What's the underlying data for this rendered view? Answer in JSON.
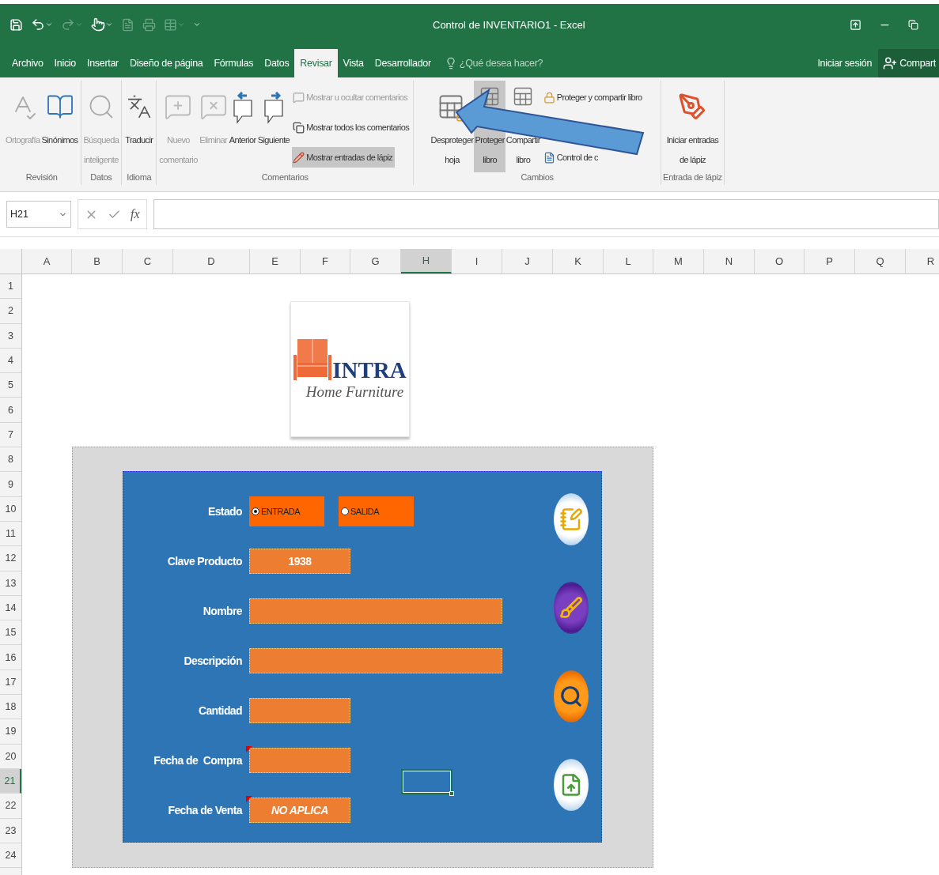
{
  "title_bar": {
    "title": "Control de INVENTARIO1 - Excel"
  },
  "menu_tabs": [
    {
      "label": "Archivo",
      "selected": false
    },
    {
      "label": "Inicio",
      "selected": false
    },
    {
      "label": "Insertar",
      "selected": false
    },
    {
      "label": "Diseño de página",
      "selected": false
    },
    {
      "label": "Fórmulas",
      "selected": false
    },
    {
      "label": "Datos",
      "selected": false
    },
    {
      "label": "Revisar",
      "selected": true
    },
    {
      "label": "Vista",
      "selected": false
    },
    {
      "label": "Desarrollador",
      "selected": false
    }
  ],
  "tell_me": {
    "placeholder": "¿Qué desea hacer?"
  },
  "account": {
    "sign_in": "Iniciar sesión",
    "share": "Compart"
  },
  "ribbon": [
    {
      "label": "Revisión",
      "commands": [
        {
          "kind": "large",
          "label": "Ortografía",
          "disabled": true,
          "selected": false
        },
        {
          "kind": "large",
          "label": "Sinónimos",
          "disabled": false,
          "selected": false
        }
      ]
    },
    {
      "label": "Datos",
      "commands": [
        {
          "kind": "large",
          "label": "Búsqueda\ninteligente",
          "disabled": true,
          "selected": false
        }
      ]
    },
    {
      "label": "Idioma",
      "commands": [
        {
          "kind": "large",
          "label": "Traducir",
          "disabled": false,
          "selected": false
        }
      ]
    },
    {
      "label": "Comentarios",
      "commands": [
        {
          "kind": "large",
          "label": "Nuevo\ncomentario",
          "disabled": true,
          "selected": false
        },
        {
          "kind": "large",
          "label": "Eliminar",
          "disabled": true,
          "selected": false
        },
        {
          "kind": "large",
          "label": "Anterior",
          "disabled": false,
          "selected": false
        },
        {
          "kind": "large",
          "label": "Siguiente",
          "disabled": false,
          "selected": false
        },
        {
          "kind": "small",
          "label": "Mostrar u ocultar comentarios",
          "disabled": true,
          "selected": false
        },
        {
          "kind": "small",
          "label": "Mostrar todos los comentarios",
          "disabled": false,
          "selected": false
        },
        {
          "kind": "small",
          "label": "Mostrar entradas de lápiz",
          "disabled": false,
          "selected": true
        }
      ]
    },
    {
      "label": "Cambios",
      "commands": [
        {
          "kind": "large",
          "label": "Desproteger\nhoja",
          "disabled": false,
          "selected": false
        },
        {
          "kind": "large",
          "label": "Proteger\nlibro",
          "disabled": false,
          "selected": true
        },
        {
          "kind": "large",
          "label": "Compartir\nlibro",
          "disabled": false,
          "selected": false
        },
        {
          "kind": "small",
          "label": "Proteger y compartir libro",
          "disabled": false,
          "selected": false
        },
        {
          "kind": "small",
          "label": "Control de c",
          "disabled": false,
          "selected": false
        }
      ]
    },
    {
      "label": "Entrada de lápiz",
      "commands": [
        {
          "kind": "large",
          "label": "Iniciar entradas\nde lápiz",
          "disabled": false,
          "selected": false
        }
      ]
    }
  ],
  "formula_bar": {
    "name_box": "H21",
    "function_label": "fx"
  },
  "columns": [
    {
      "label": "A",
      "selected": false
    },
    {
      "label": "B",
      "selected": false
    },
    {
      "label": "C",
      "selected": false
    },
    {
      "label": "D",
      "selected": false
    },
    {
      "label": "E",
      "selected": false
    },
    {
      "label": "F",
      "selected": false
    },
    {
      "label": "G",
      "selected": false
    },
    {
      "label": "H",
      "selected": true
    },
    {
      "label": "I",
      "selected": false
    },
    {
      "label": "J",
      "selected": false
    },
    {
      "label": "K",
      "selected": false
    },
    {
      "label": "L",
      "selected": false
    },
    {
      "label": "M",
      "selected": false
    },
    {
      "label": "N",
      "selected": false
    },
    {
      "label": "O",
      "selected": false
    },
    {
      "label": "P",
      "selected": false
    },
    {
      "label": "Q",
      "selected": false
    },
    {
      "label": "R",
      "selected": false
    }
  ],
  "rows": [
    {
      "label": "1",
      "selected": false
    },
    {
      "label": "2",
      "selected": false
    },
    {
      "label": "3",
      "selected": false
    },
    {
      "label": "4",
      "selected": false
    },
    {
      "label": "5",
      "selected": false
    },
    {
      "label": "6",
      "selected": false
    },
    {
      "label": "7",
      "selected": false
    },
    {
      "label": "8",
      "selected": false
    },
    {
      "label": "9",
      "selected": false
    },
    {
      "label": "10",
      "selected": false
    },
    {
      "label": "11",
      "selected": false
    },
    {
      "label": "12",
      "selected": false
    },
    {
      "label": "13",
      "selected": false
    },
    {
      "label": "14",
      "selected": false
    },
    {
      "label": "15",
      "selected": false
    },
    {
      "label": "16",
      "selected": false
    },
    {
      "label": "17",
      "selected": false
    },
    {
      "label": "18",
      "selected": false
    },
    {
      "label": "19",
      "selected": false
    },
    {
      "label": "20",
      "selected": false
    },
    {
      "label": "21",
      "selected": true
    },
    {
      "label": "22",
      "selected": false
    },
    {
      "label": "23",
      "selected": false
    },
    {
      "label": "24",
      "selected": false
    }
  ],
  "logo": {
    "name": "INTRA",
    "tagline": "Home Furniture"
  },
  "form": {
    "fields": [
      {
        "kind": "radio",
        "label": "Estado",
        "options": [
          {
            "label": "ENTRADA",
            "selected": true
          },
          {
            "label": "SALIDA",
            "selected": false
          }
        ]
      },
      {
        "kind": "field",
        "label": "Clave Producto",
        "wide": false,
        "value": "1938",
        "italic": false,
        "comment": false
      },
      {
        "kind": "field",
        "label": "Nombre",
        "wide": true,
        "comment": false
      },
      {
        "kind": "field",
        "label": "Descripción",
        "wide": true,
        "comment": false
      },
      {
        "kind": "field",
        "label": "Cantidad",
        "wide": false,
        "comment": false
      },
      {
        "kind": "field",
        "label": "Fecha de  Compra",
        "wide": false,
        "comment": true
      },
      {
        "kind": "field",
        "label": "Fecha de Venta",
        "wide": false,
        "value": "NO APLICA",
        "italic": true,
        "comment": true
      }
    ]
  }
}
